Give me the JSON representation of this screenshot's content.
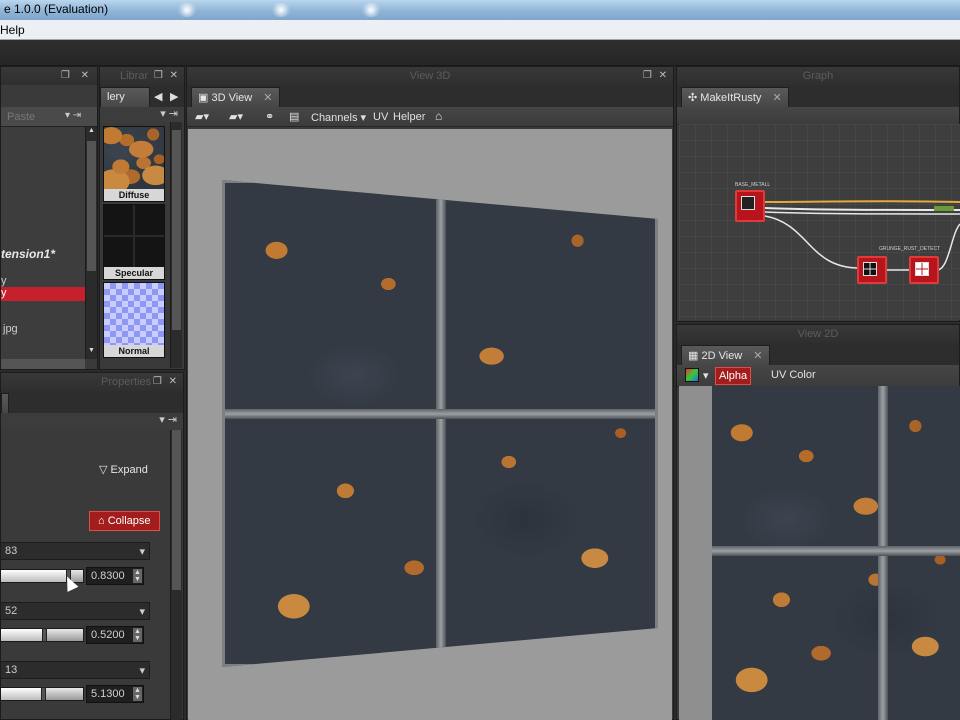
{
  "window": {
    "title": "e 1.0.0 (Evaluation)"
  },
  "menu": {
    "items": [
      "Help"
    ]
  },
  "explorer": {
    "head_buttons": "❐ ✕",
    "tab_label": "Paste",
    "items": [
      "tension1*",
      "y",
      "y",
      "jpg"
    ],
    "scroll_up": "▲",
    "scroll_down": "▼"
  },
  "gallery": {
    "panel_label": "Librar",
    "tab_label": "lery",
    "prev": "◀",
    "next": "▶",
    "thumbs": [
      {
        "label": "Diffuse"
      },
      {
        "label": "Specular"
      },
      {
        "label": "Normal"
      }
    ]
  },
  "view3d": {
    "panel_label": "View 3D",
    "tab_label": "3D View",
    "tab_close": "✕",
    "toolbar": {
      "channels": "Channels ▾",
      "uv": "UV",
      "helper": "Helper",
      "home_icon": "home-icon"
    }
  },
  "graph": {
    "panel_label": "Graph",
    "tab_label": "MakeItRusty",
    "tab_close": "✕",
    "node_labels": [
      "BASE_METALL",
      "GRUNGE_RUST_DETECT"
    ]
  },
  "view2d": {
    "panel_label": "View 2D",
    "tab_label": "2D View",
    "tab_close": "✕",
    "toolbar": {
      "alpha": "Alpha",
      "uv_color": "UV Color"
    }
  },
  "properties": {
    "panel_label": "Properties",
    "expand": "▽  Expand",
    "collapse": "⌂  Collapse",
    "params": [
      {
        "label": "83",
        "value": "0.8300",
        "level": 0.83
      },
      {
        "label": "52",
        "value": "0.5200",
        "level": 0.52
      },
      {
        "label": "13",
        "value": "5.1300",
        "level": 0.513
      }
    ],
    "dropdown_arrow": "▾",
    "spin_up": "▲",
    "spin_down": "▼"
  },
  "colors": {
    "accent_red": "#b8141c",
    "panel_bg": "#3a3a3a",
    "viewport_bg": "#9b9b9b"
  }
}
